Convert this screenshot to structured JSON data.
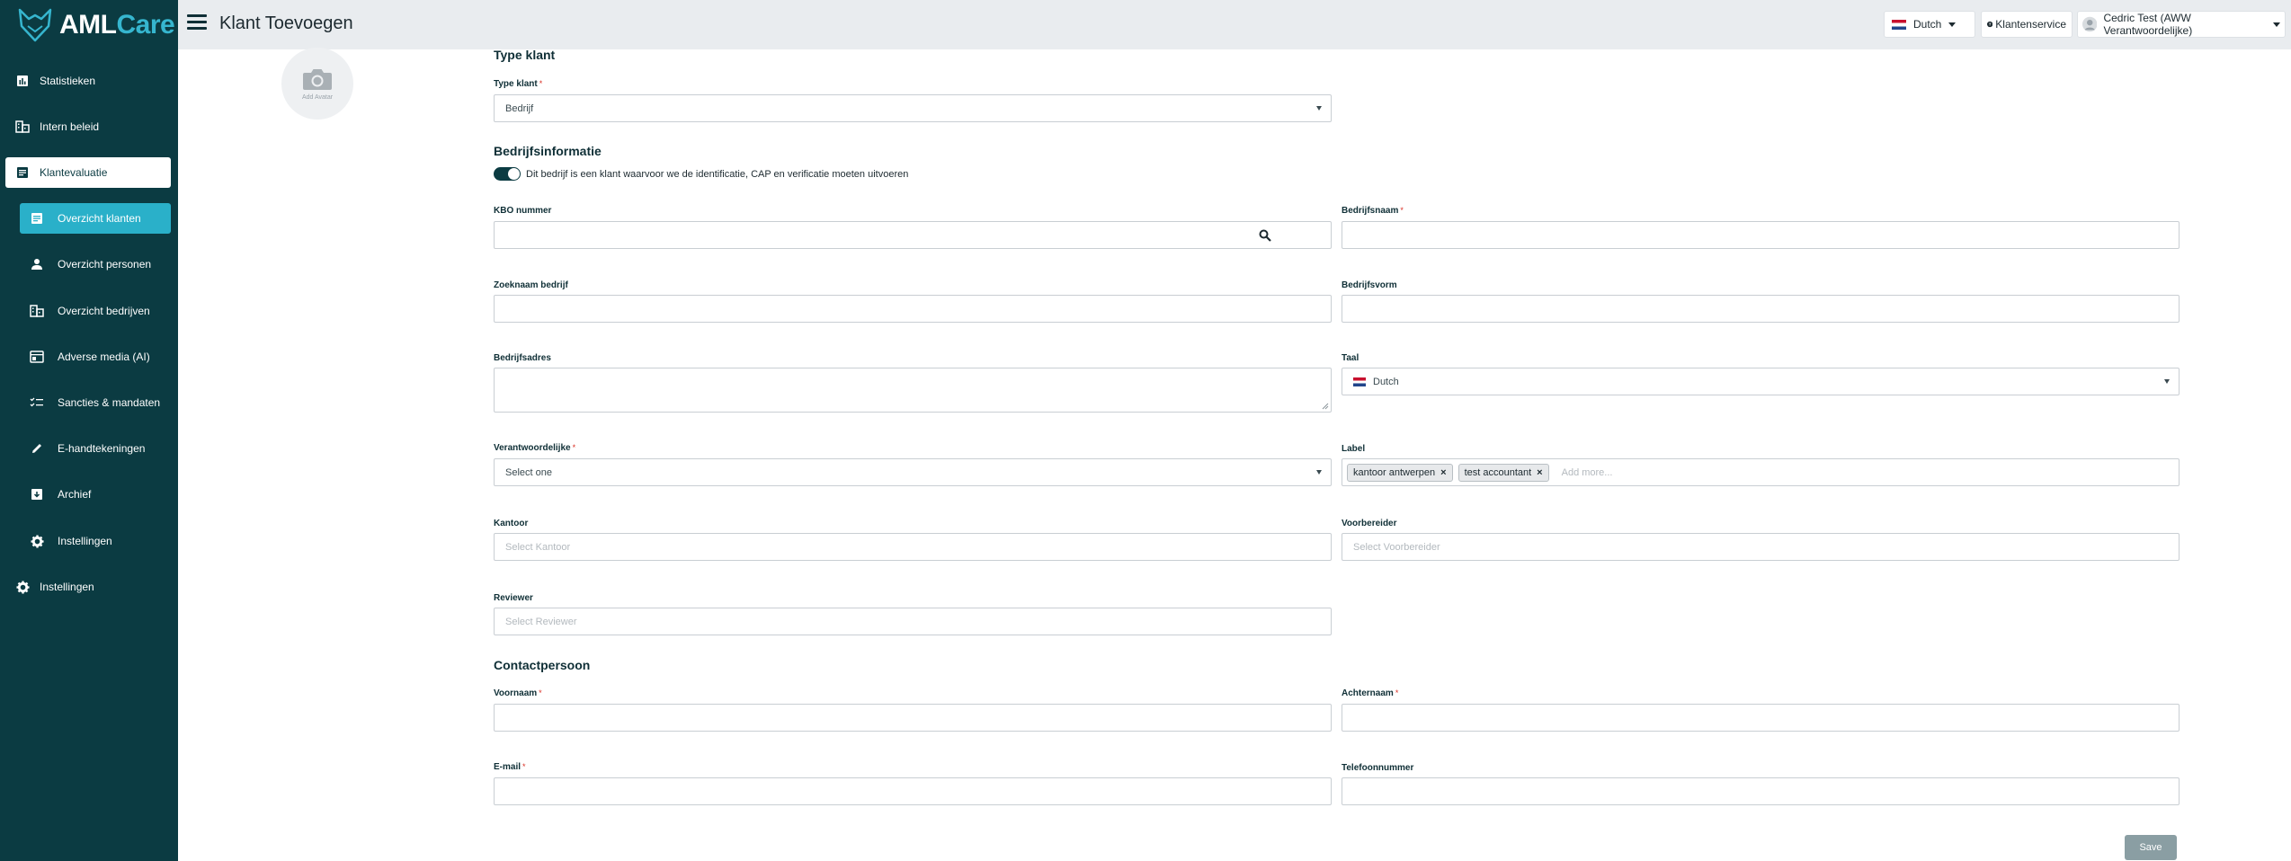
{
  "brand": {
    "name_part1": "AML",
    "name_part2": "Care"
  },
  "header": {
    "title": "Klant Toevoegen",
    "language": "Dutch",
    "support": "Klantenservice",
    "user": "Cedric Test (AWW Verantwoordelijke)"
  },
  "sidebar": {
    "items": [
      {
        "label": "Statistieken",
        "icon": "chart-icon"
      },
      {
        "label": "Intern beleid",
        "icon": "building-icon"
      },
      {
        "label": "Klantevaluatie",
        "icon": "document-icon"
      },
      {
        "label": "Overzicht klanten",
        "icon": "document-icon"
      },
      {
        "label": "Overzicht personen",
        "icon": "person-icon"
      },
      {
        "label": "Overzicht bedrijven",
        "icon": "building-icon"
      },
      {
        "label": "Adverse media (AI)",
        "icon": "media-icon"
      },
      {
        "label": "Sancties & mandaten",
        "icon": "checklist-icon"
      },
      {
        "label": "E-handtekeningen",
        "icon": "pen-icon"
      },
      {
        "label": "Archief",
        "icon": "archive-icon"
      },
      {
        "label": "Instellingen",
        "icon": "gear-icon"
      },
      {
        "label": "Instellingen",
        "icon": "gear-icon"
      }
    ]
  },
  "avatar": {
    "label": "Add Avatar"
  },
  "form": {
    "type_section": "Type klant",
    "type_label": "Type klant",
    "type_value": "Bedrijf",
    "company_section": "Bedrijfsinformatie",
    "toggle_text": "Dit bedrijf is een klant waarvoor we de identificatie, CAP en verificatie moeten uitvoeren",
    "kbo_label": "KBO nummer",
    "bedrijfsnaam_label": "Bedrijfsnaam",
    "zoeknaam_label": "Zoeknaam bedrijf",
    "bedrijfsvorm_label": "Bedrijfsvorm",
    "adres_label": "Bedrijfsadres",
    "taal_label": "Taal",
    "taal_value": "Dutch",
    "verantwoordelijke_label": "Verantwoordelijke",
    "verantwoordelijke_value": "Select one",
    "label_label": "Label",
    "tags": [
      "kantoor antwerpen",
      "test accountant"
    ],
    "add_more": "Add more...",
    "kantoor_label": "Kantoor",
    "kantoor_placeholder": "Select Kantoor",
    "voorbereider_label": "Voorbereider",
    "voorbereider_placeholder": "Select Voorbereider",
    "reviewer_label": "Reviewer",
    "reviewer_placeholder": "Select Reviewer",
    "contact_section": "Contactpersoon",
    "voornaam_label": "Voornaam",
    "achternaam_label": "Achternaam",
    "email_label": "E-mail",
    "telefoon_label": "Telefoonnummer",
    "save_label": "Save",
    "required_mark": "*"
  }
}
